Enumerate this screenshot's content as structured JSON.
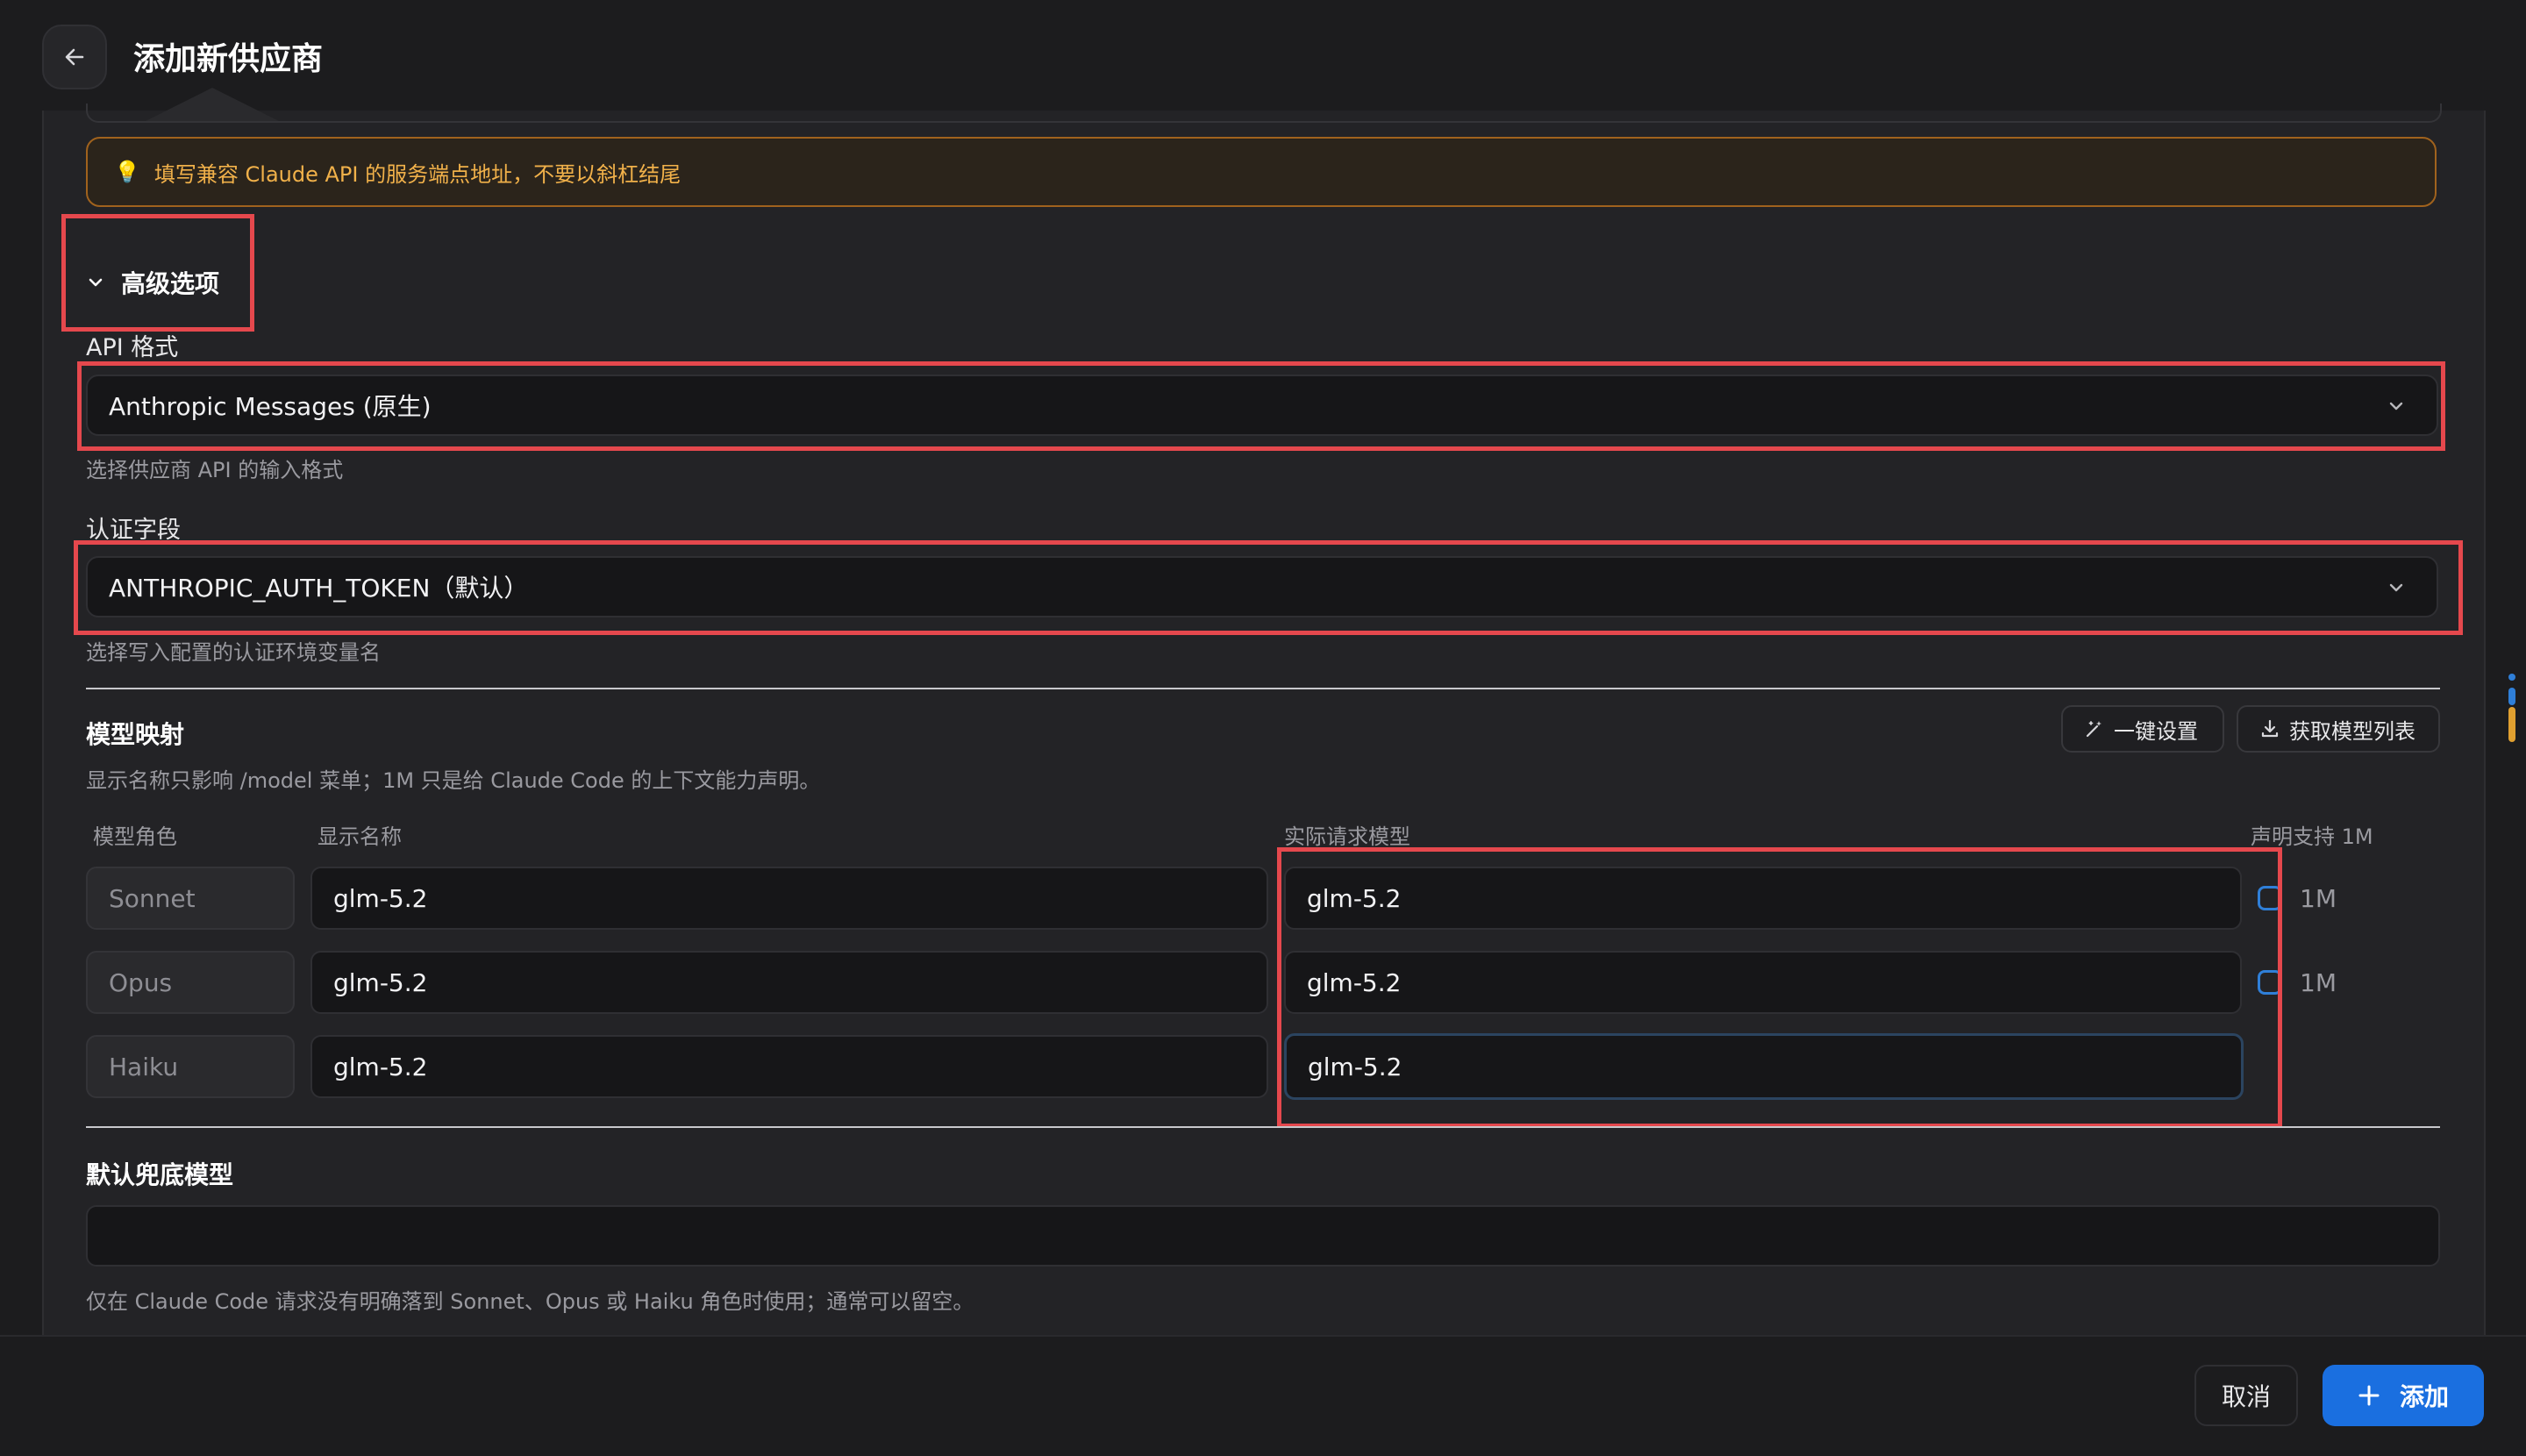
{
  "header": {
    "title": "添加新供应商"
  },
  "hint": {
    "text": "填写兼容 Claude API 的服务端点地址，不要以斜杠结尾"
  },
  "advanced": {
    "label": "高级选项"
  },
  "api_format": {
    "label": "API 格式",
    "value": "Anthropic Messages (原生)",
    "help": "选择供应商 API 的输入格式"
  },
  "auth_field": {
    "label": "认证字段",
    "value": "ANTHROPIC_AUTH_TOKEN（默认）",
    "help": "选择写入配置的认证环境变量名"
  },
  "model_mapping": {
    "title": "模型映射",
    "desc": "显示名称只影响 /model 菜单；1M 只是给 Claude Code 的上下文能力声明。",
    "one_click_label": "一键设置",
    "fetch_label": "获取模型列表",
    "columns": {
      "role": "模型角色",
      "display": "显示名称",
      "actual": "实际请求模型",
      "declare": "声明支持 1M"
    },
    "rows": [
      {
        "role": "Sonnet",
        "display": "glm-5.2",
        "actual": "glm-5.2",
        "declare_label": "1M"
      },
      {
        "role": "Opus",
        "display": "glm-5.2",
        "actual": "glm-5.2",
        "declare_label": "1M"
      },
      {
        "role": "Haiku",
        "display": "glm-5.2",
        "actual": "glm-5.2"
      }
    ]
  },
  "fallback": {
    "title": "默认兜底模型",
    "value": "",
    "help": "仅在 Claude Code 请求没有明确落到 Sonnet、Opus 或 Haiku 角色时使用；通常可以留空。"
  },
  "footer": {
    "cancel_label": "取消",
    "add_label": "添加"
  },
  "colors": {
    "accent": "#1a6fe0",
    "highlight": "#e5484d",
    "warning": "#f1b14a"
  }
}
